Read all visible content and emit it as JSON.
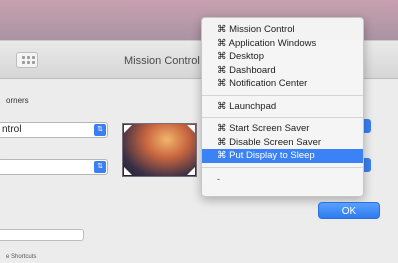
{
  "window": {
    "title": "Mission Control"
  },
  "section": {
    "label": "orners"
  },
  "popups": {
    "top_left": "ntrol",
    "bottom_left": ""
  },
  "menu": {
    "items_group1": [
      "⌘ Mission Control",
      "⌘ Application Windows",
      "⌘ Desktop",
      "⌘ Dashboard",
      "⌘ Notification Center"
    ],
    "items_group2": [
      "⌘ Launchpad"
    ],
    "items_group3": [
      "⌘ Start Screen Saver",
      "⌘ Disable Screen Saver",
      "⌘ Put Display to Sleep"
    ],
    "selected": "⌘ Put Display to Sleep",
    "dash": "-"
  },
  "buttons": {
    "ok": "OK"
  },
  "footer": {
    "text": "e Shortcuts"
  },
  "colors": {
    "accent": "#3b82f6",
    "wallpaper": "#b89aa8"
  }
}
